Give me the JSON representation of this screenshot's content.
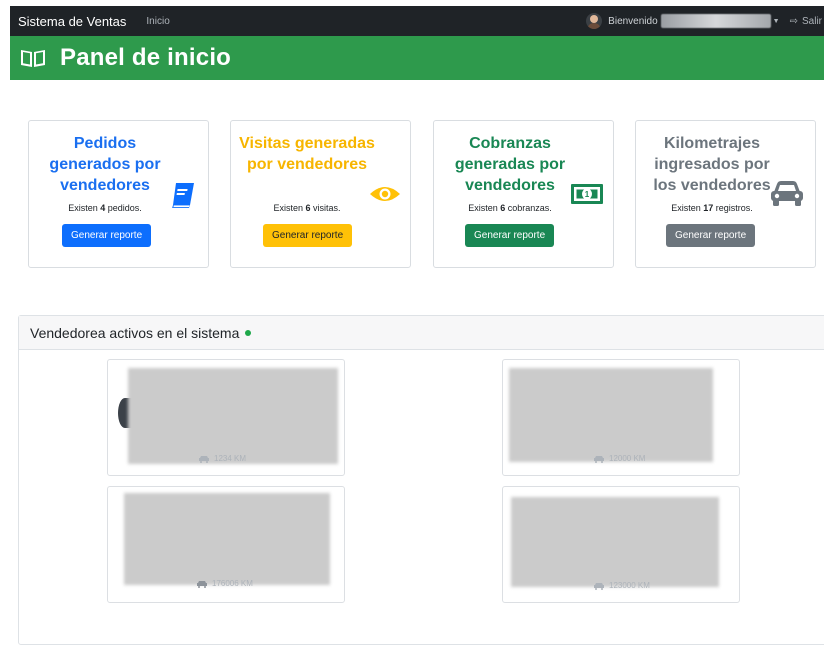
{
  "navbar": {
    "brand": "Sistema de Ventas",
    "home_link": "Inicio",
    "welcome": "Bienvenido",
    "logout": "Salir"
  },
  "header": {
    "title": "Panel de inicio",
    "icon": "book-open-icon"
  },
  "cards": [
    {
      "title": "Pedidos generados por vendedores",
      "desc_prefix": "Existen",
      "count": "4",
      "desc_suffix": "pedidos.",
      "button": "Generar reporte",
      "color": "#0d6efd",
      "icon": "book-icon"
    },
    {
      "title": "Visitas generadas por vendedores",
      "desc_prefix": "Existen",
      "count": "6",
      "desc_suffix": "visitas.",
      "button": "Generar reporte",
      "color": "#ffc107",
      "icon": "eye-icon"
    },
    {
      "title": "Cobranzas generadas por vendedores",
      "desc_prefix": "Existen",
      "count": "6",
      "desc_suffix": "cobranzas.",
      "button": "Generar reporte",
      "color": "#198754",
      "icon": "money-bill-icon"
    },
    {
      "title": "Kilometrajes ingresados por los vendedores",
      "desc_prefix": "Existen",
      "count": "17",
      "desc_suffix": "registros.",
      "button": "Generar reporte",
      "color": "#6c757d",
      "icon": "car-icon"
    }
  ],
  "active_sellers": {
    "title": "Vendedorea activos en el sistema",
    "status_color": "#1ea84a",
    "sellers": [
      {
        "km": "1234 KM"
      },
      {
        "km": "12000 KM"
      },
      {
        "km": "176006 KM"
      },
      {
        "km": "123000 KM"
      }
    ]
  }
}
